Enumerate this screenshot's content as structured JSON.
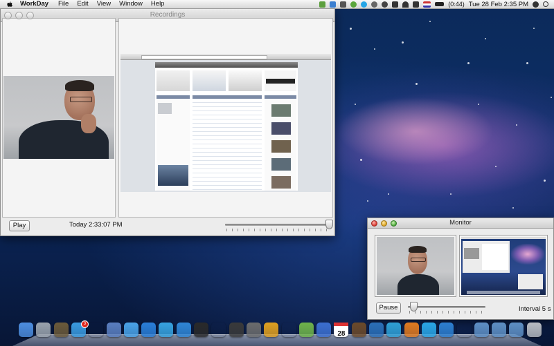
{
  "menubar": {
    "apple": "apple-icon",
    "app_name": "WorkDay",
    "items": [
      "File",
      "Edit",
      "View",
      "Window",
      "Help"
    ],
    "battery": "(0:44)",
    "clock": "Tue 28 Feb  2:35 PM"
  },
  "recordings": {
    "title": "Recordings",
    "play_label": "Play",
    "timestamp": "Today 2:33:07 PM",
    "slider_level": 1.0
  },
  "monitor": {
    "title": "Monitor",
    "pause_label": "Pause",
    "interval_label": "Interval 5 s",
    "slider_level": 0.03
  },
  "colors": {
    "menubar_bg": "#e4e4e4",
    "window_bg": "#ececec",
    "desktop": "#0d2e66"
  },
  "dock": {
    "icons": [
      "finder-icon",
      "rocket-icon",
      "photo-icon",
      "app-store-icon",
      "clock-icon",
      "preview-icon",
      "itunes-icon",
      "messages-icon",
      "twitter-icon",
      "safari-icon",
      "sound-icon",
      "eye-icon",
      "dashboard-icon",
      "script-icon",
      "plex-icon",
      "ink-icon",
      "numbers-icon",
      "keynote-icon",
      "calendar-icon",
      "photos-icon",
      "globe-icon",
      "cam-icon",
      "vlc-icon",
      "skype-icon",
      "mail-icon",
      "terminal-icon",
      "folder-icon",
      "folder-icon",
      "folder-icon",
      "trash-icon"
    ],
    "calendar_day": "28",
    "badge": "3"
  }
}
